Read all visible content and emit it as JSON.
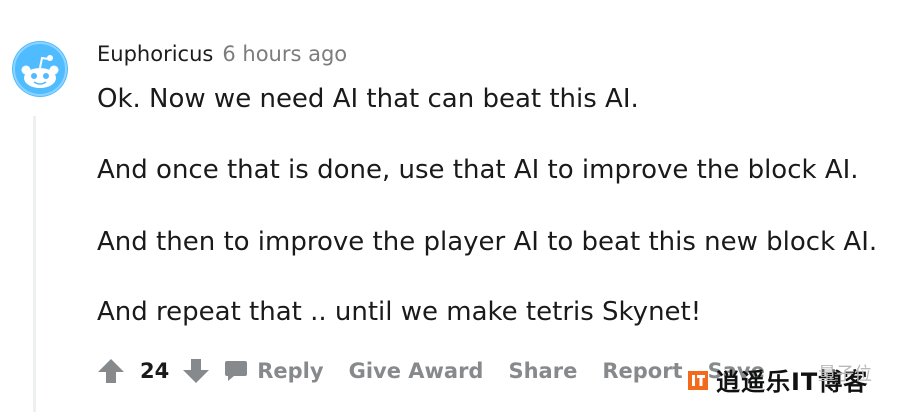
{
  "comment": {
    "author": "Euphoricus",
    "timestamp": "6 hours ago",
    "paragraphs": [
      "Ok. Now we need AI that can beat this AI.",
      "And once that is done, use that AI to improve the block AI.",
      "And then to improve the player AI to beat this new block AI.",
      "And repeat that .. until we make tetris Skynet!"
    ],
    "votes": "24"
  },
  "actions": {
    "reply": "Reply",
    "give_award": "Give Award",
    "share": "Share",
    "report": "Report",
    "save": "Save"
  },
  "watermark": {
    "logo_text": "逍遥乐IT博客",
    "right_text": "量子位"
  },
  "colors": {
    "text": "#1a1a1b",
    "muted": "#878a8c",
    "avatar_bg": "#4fbcff",
    "thread_line": "#edeff1",
    "logo_orange": "#f26b1d"
  },
  "icons": [
    "snoo-avatar-icon",
    "upvote-icon",
    "downvote-icon",
    "comment-icon"
  ]
}
